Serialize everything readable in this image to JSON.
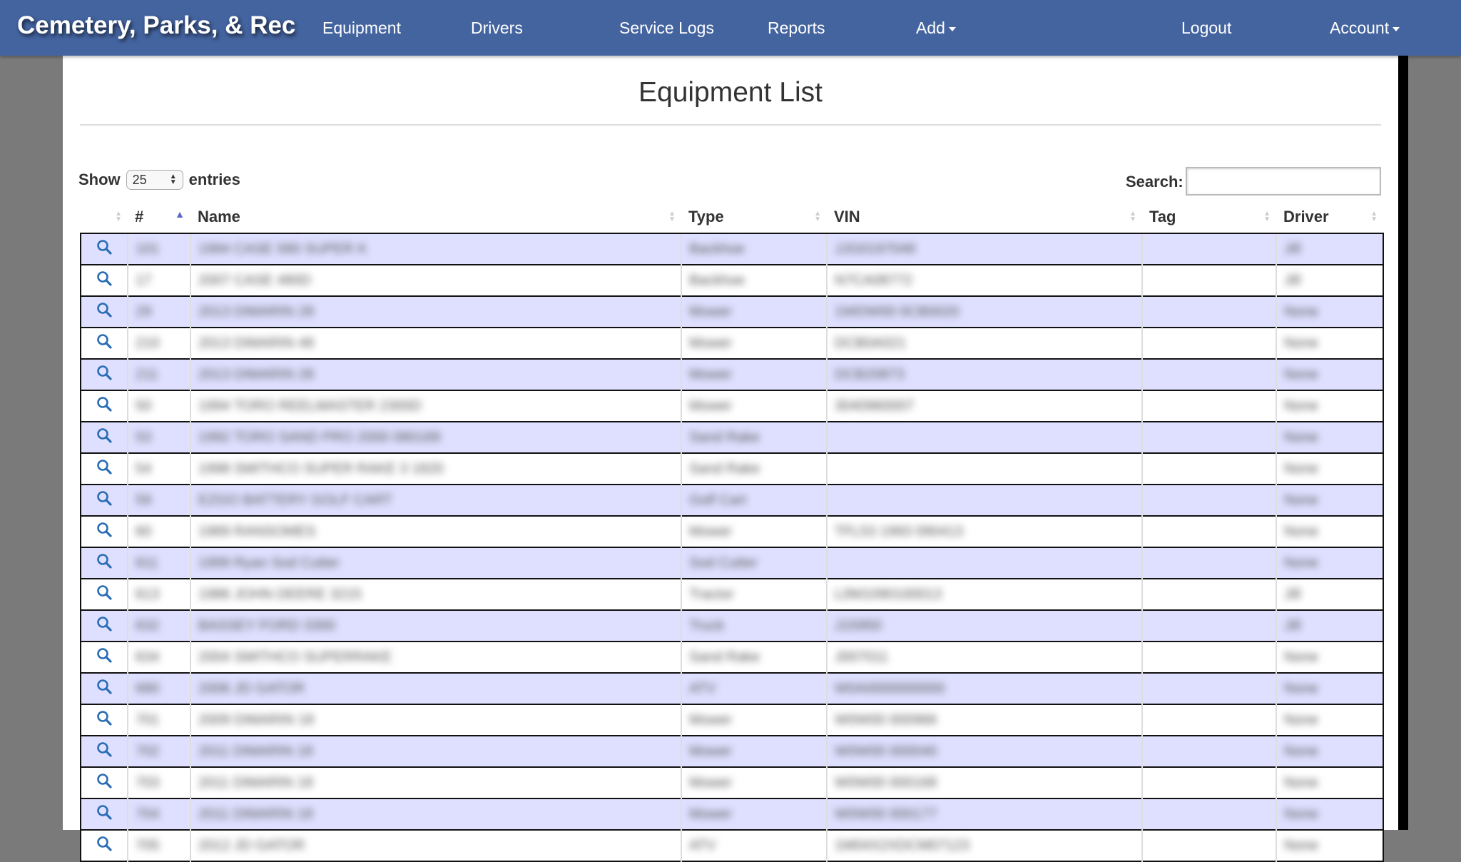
{
  "navbar": {
    "brand": "Cemetery, Parks, & Rec",
    "items": {
      "equipment": "Equipment",
      "drivers": "Drivers",
      "service_logs": "Service Logs",
      "reports": "Reports",
      "add": "Add",
      "logout": "Logout",
      "account": "Account"
    },
    "color": "#4464a0"
  },
  "page": {
    "title": "Equipment List"
  },
  "length_control": {
    "show_label": "Show",
    "selected": "25",
    "entries_label": "entries"
  },
  "search": {
    "label": "Search:",
    "value": ""
  },
  "table": {
    "columns": [
      "#",
      "Name",
      "Type",
      "VIN",
      "Tag",
      "Driver"
    ],
    "sorted_column": "#",
    "row_action_icon": "search-icon",
    "rows": [
      {
        "num": "101",
        "name": "1994 CASE 580 SUPER K",
        "type": "Backhoe",
        "vin": "JJG0197048",
        "tag": "",
        "driver": "Jill"
      },
      {
        "num": "17",
        "name": "2007 CASE 480D",
        "type": "Backhoe",
        "vin": "N7CA08772",
        "tag": "",
        "driver": "Jill"
      },
      {
        "num": "29",
        "name": "2013 DIMARIN 28",
        "type": "Mower",
        "vin": "1WDW00 0CB0020",
        "tag": "",
        "driver": "None"
      },
      {
        "num": "210",
        "name": "2013 DIMARIN 48",
        "type": "Mower",
        "vin": "DCB0A021",
        "tag": "",
        "driver": "None"
      },
      {
        "num": "211",
        "name": "2013 DIMARIN 28",
        "type": "Mower",
        "vin": "DCB20873",
        "tag": "",
        "driver": "None"
      },
      {
        "num": "50",
        "name": "1994 TORO REELMASTER 2300D",
        "type": "Mower",
        "vin": "3040960007",
        "tag": "",
        "driver": "None"
      },
      {
        "num": "53",
        "name": "1992 TORO SAND PRO 2000 080189",
        "type": "Sand Rake",
        "vin": "",
        "tag": "",
        "driver": "None"
      },
      {
        "num": "54",
        "name": "1998 SMITHCO SUPER RAKE 3 1820",
        "type": "Sand Rake",
        "vin": "",
        "tag": "",
        "driver": "None"
      },
      {
        "num": "59",
        "name": "EZGO BATTERY GOLF CART",
        "type": "Golf Cart",
        "vin": "",
        "tag": "",
        "driver": "None"
      },
      {
        "num": "60",
        "name": "1989 RANSOMES",
        "type": "Mower",
        "vin": "TFL53 1993 090413",
        "tag": "",
        "driver": "None"
      },
      {
        "num": "611",
        "name": "1999 Ryan Sod Cutter",
        "type": "Sod Cutter",
        "vin": "",
        "tag": "",
        "driver": "None"
      },
      {
        "num": "613",
        "name": "1986 JOHN DEERE 3215",
        "type": "Tractor",
        "vin": "L0M1090100013",
        "tag": "",
        "driver": "Jill"
      },
      {
        "num": "632",
        "name": "BASSEY FORD 3300",
        "type": "Truck",
        "vin": "J15950",
        "tag": "",
        "driver": "Jill"
      },
      {
        "num": "634",
        "name": "2004 SMITHCO SUPERRAKE",
        "type": "Sand Rake",
        "vin": "J007011",
        "tag": "",
        "driver": "None"
      },
      {
        "num": "680",
        "name": "2006 JD GATOR",
        "type": "ATV",
        "vin": "W0A0000000000",
        "tag": "",
        "driver": "None"
      },
      {
        "num": "701",
        "name": "2009 DIMARIN 18",
        "type": "Mower",
        "vin": "W0W00 000966",
        "tag": "",
        "driver": "None"
      },
      {
        "num": "702",
        "name": "2011 DIMARIN 18",
        "type": "Mower",
        "vin": "W0W00 000040",
        "tag": "",
        "driver": "None"
      },
      {
        "num": "703",
        "name": "2011 DIMARIN 18",
        "type": "Mower",
        "vin": "W0W00 000168",
        "tag": "",
        "driver": "None"
      },
      {
        "num": "704",
        "name": "2011 DIMARIN 18",
        "type": "Mower",
        "vin": "W0W00 000177",
        "tag": "",
        "driver": "None"
      },
      {
        "num": "705",
        "name": "2012 JD GATOR",
        "type": "ATV",
        "vin": "1M04X2XDCM07123",
        "tag": "",
        "driver": "None"
      }
    ]
  }
}
